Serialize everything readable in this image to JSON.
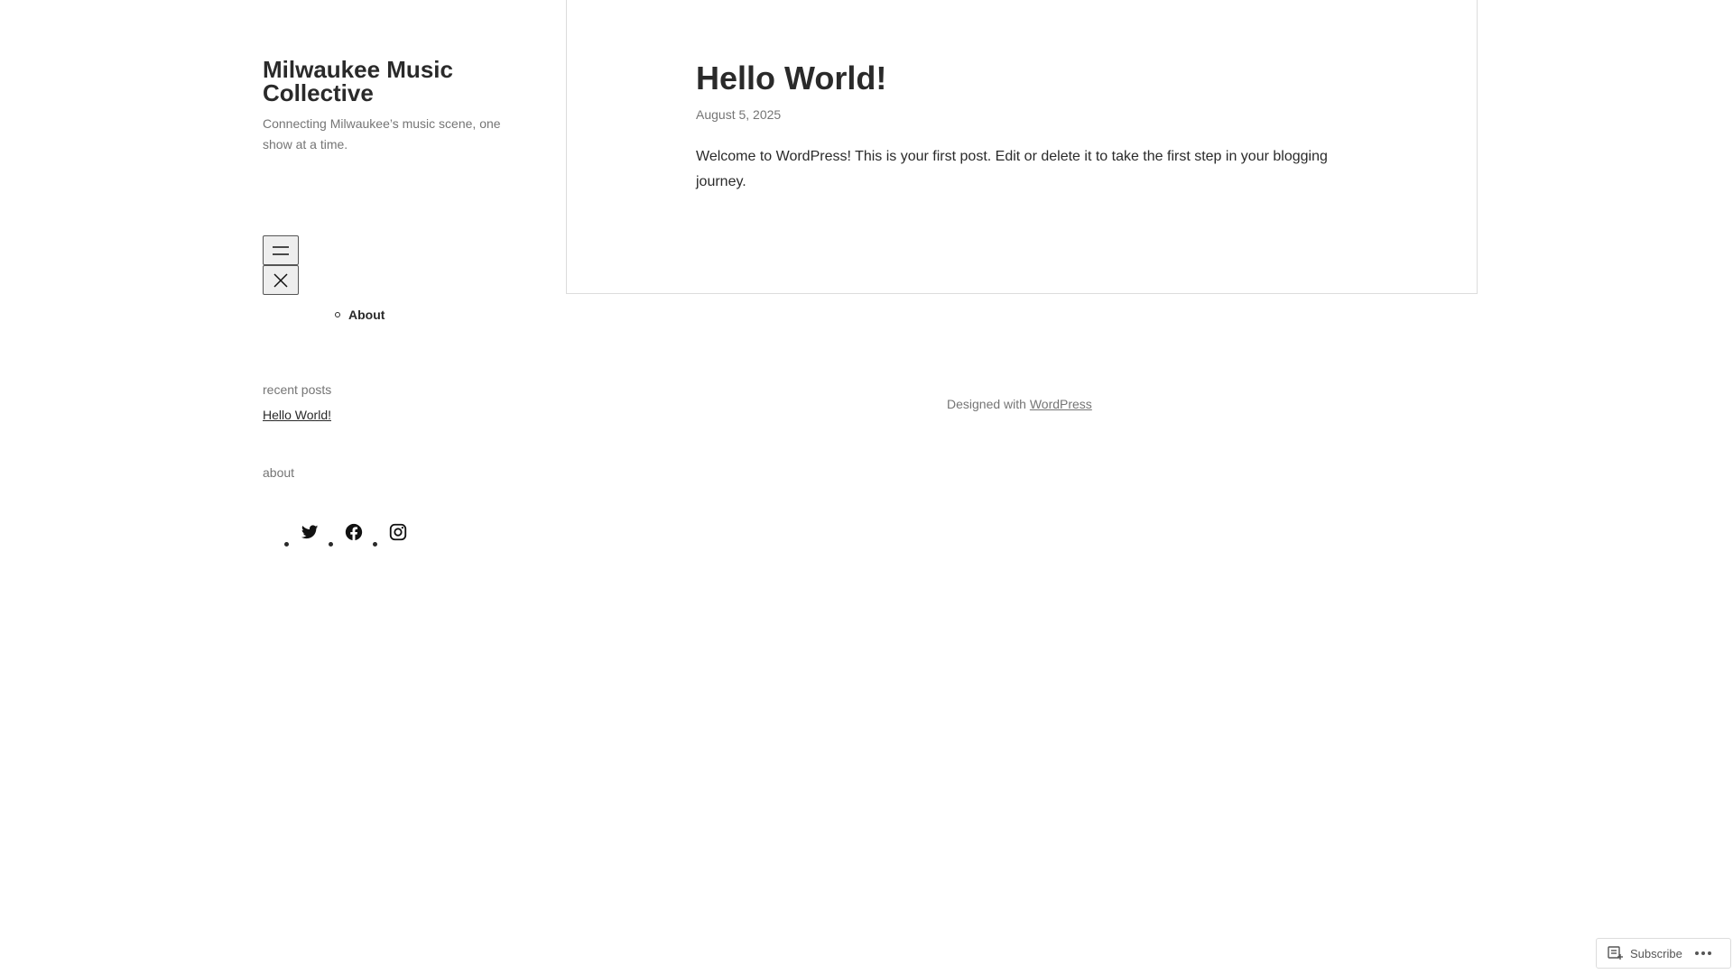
{
  "site": {
    "title": "Milwaukee Music Collective",
    "tagline": "Connecting Milwaukee’s music scene, one show at a time."
  },
  "nav": {
    "open_icon": "hamburger-menu-icon",
    "close_icon": "close-icon",
    "items": [
      {
        "label": "About"
      }
    ]
  },
  "widgets": {
    "recent_posts": {
      "title": "recent posts",
      "items": [
        {
          "label": "Hello World!"
        }
      ]
    },
    "about": {
      "title": "about",
      "social": [
        "twitter-icon",
        "facebook-icon",
        "instagram-icon"
      ]
    }
  },
  "post": {
    "title": "Hello World!",
    "date": "August 5, 2025",
    "body": "Welcome to WordPress! This is your first post. Edit or delete it to take the first step in your blogging journey."
  },
  "footer": {
    "credit_prefix": "Designed with",
    "credit_link": "WordPress"
  },
  "subscribe_bar": {
    "subscribe_label": "Subscribe",
    "subscribe_icon": "reader-icon",
    "more_icon": "ellipsis-icon"
  },
  "colors": {
    "text": "#2a2a2a",
    "muted": "#757575",
    "border": "#dcdcdc"
  }
}
